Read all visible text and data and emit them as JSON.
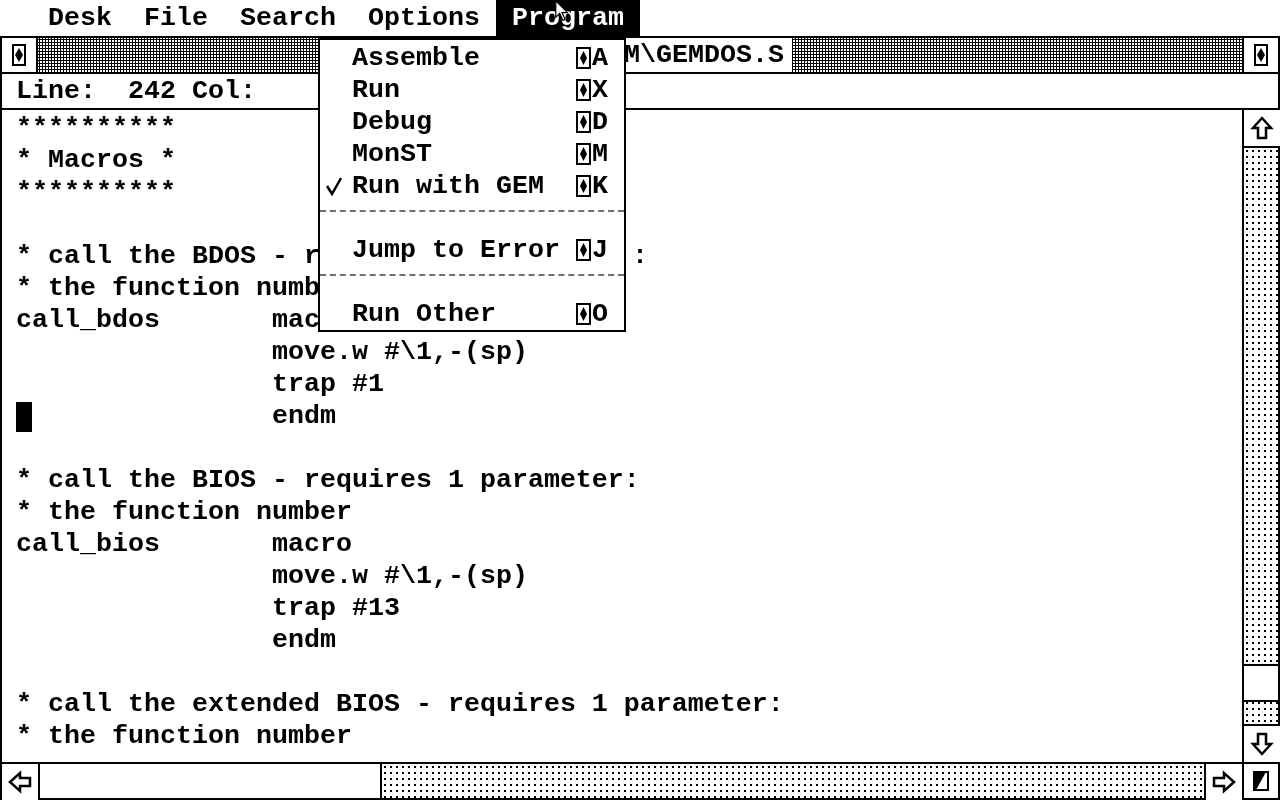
{
  "menu_bar": [
    {
      "label": "Desk",
      "selected": false
    },
    {
      "label": "File",
      "selected": false
    },
    {
      "label": "Search",
      "selected": false
    },
    {
      "label": "Options",
      "selected": false
    },
    {
      "label": "Program",
      "selected": true
    }
  ],
  "window": {
    "title": "M\\GEMDOS.S",
    "info": "Line:  242 Col:"
  },
  "editor": {
    "lines": [
      {
        "kind": "code",
        "text": "**********",
        "cursor": false
      },
      {
        "kind": "code",
        "text": "* Macros *",
        "cursor": false
      },
      {
        "kind": "code",
        "text": "**********",
        "cursor": false
      },
      {
        "kind": "blank",
        "cursor": false
      },
      {
        "kind": "code",
        "text": "* call the BDOS - r",
        "tail": ":",
        "cursor": false
      },
      {
        "kind": "code",
        "text": "* the function numb",
        "cursor": false
      },
      {
        "kind": "code",
        "text": "call_bdos       mac",
        "cursor": false
      },
      {
        "kind": "code",
        "text": "                move.w #\\1,-(sp)",
        "cursor": false
      },
      {
        "kind": "code",
        "text": "                trap #1",
        "cursor": false
      },
      {
        "kind": "code",
        "text": "                endm",
        "cursor": true
      },
      {
        "kind": "blank",
        "cursor": false
      },
      {
        "kind": "code",
        "text": "* call the BIOS - requires 1 parameter:",
        "cursor": false
      },
      {
        "kind": "code",
        "text": "* the function number",
        "cursor": false
      },
      {
        "kind": "code",
        "text": "call_bios       macro",
        "cursor": false
      },
      {
        "kind": "code",
        "text": "                move.w #\\1,-(sp)",
        "cursor": false
      },
      {
        "kind": "code",
        "text": "                trap #13",
        "cursor": false
      },
      {
        "kind": "code",
        "text": "                endm",
        "cursor": false
      },
      {
        "kind": "blank",
        "cursor": false
      },
      {
        "kind": "code",
        "text": "* call the extended BIOS - requires 1 parameter:",
        "cursor": false
      },
      {
        "kind": "code",
        "text": "* the function number",
        "cursor": false
      }
    ]
  },
  "dropdown": {
    "items": [
      {
        "kind": "item",
        "label": "Assemble",
        "shortcut": "A",
        "checked": false
      },
      {
        "kind": "item",
        "label": "Run",
        "shortcut": "X",
        "checked": false
      },
      {
        "kind": "item",
        "label": "Debug",
        "shortcut": "D",
        "checked": false
      },
      {
        "kind": "item",
        "label": "MonST",
        "shortcut": "M",
        "checked": false
      },
      {
        "kind": "item",
        "label": "Run with GEM",
        "shortcut": "K",
        "checked": true
      },
      {
        "kind": "separator"
      },
      {
        "kind": "item",
        "label": "Jump to Error",
        "shortcut": "J",
        "checked": false
      },
      {
        "kind": "separator"
      },
      {
        "kind": "item",
        "label": "Run Other",
        "shortcut": "O",
        "checked": false
      }
    ]
  }
}
